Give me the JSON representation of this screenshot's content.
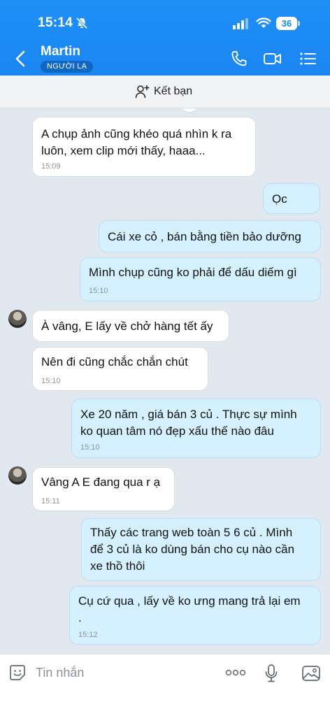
{
  "status_bar": {
    "time": "15:14",
    "battery": "36"
  },
  "header": {
    "contact_name": "Martin",
    "badge": "NGƯỜI LẠ",
    "accent": "#1a86f2"
  },
  "add_friend": {
    "label": "Kết bạn"
  },
  "messages": [
    {
      "side": "in",
      "lines": [
        "A chụp ảnh cũng khéo quá nhìn k ra",
        "luôn, xem clip mới thấy, haaa..."
      ],
      "time": "15:09"
    },
    {
      "side": "out",
      "lines": [
        "Ọc"
      ],
      "time": ""
    },
    {
      "side": "out",
      "lines": [
        "Cái xe cỏ , bán bằng tiền bảo dưỡng"
      ],
      "time": ""
    },
    {
      "side": "out",
      "lines": [
        "Mình chụp cũng ko phải để dấu diếm gì"
      ],
      "time": "15:10"
    },
    {
      "side": "in",
      "lines": [
        "À vâng, E lấy về chở hàng tết ấy"
      ],
      "time": ""
    },
    {
      "side": "in",
      "lines": [
        "Nên đi cũng chắc chắn chút"
      ],
      "time": "15:10"
    },
    {
      "side": "out",
      "lines": [
        "Xe 20 năm , giá bán 3 củ . Thực sự mình",
        "ko quan tâm nó đẹp xấu thế nào đâu"
      ],
      "time": "15:10"
    },
    {
      "side": "in",
      "lines": [
        "Vâng A E đang qua r ạ"
      ],
      "time": "15:11"
    },
    {
      "side": "out",
      "lines": [
        "Thấy các trang web toàn 5 6 củ . Mình",
        "để 3 củ là ko dùng bán cho cụ nào cần",
        "xe thồ thôi"
      ],
      "time": ""
    },
    {
      "side": "out",
      "lines": [
        "Cụ cứ qua , lấy về ko ưng mang trả lại em",
        "."
      ],
      "time": "15:12"
    }
  ],
  "input": {
    "placeholder": "Tin nhắn"
  }
}
